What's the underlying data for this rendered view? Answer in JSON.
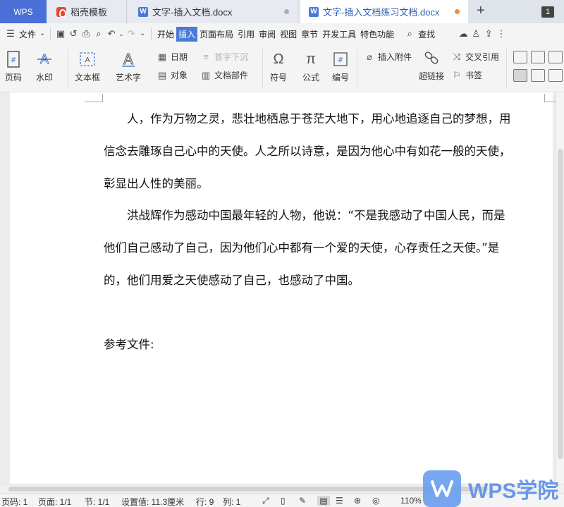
{
  "tabs": {
    "wps": "WPS",
    "template": "稻壳模板",
    "doc1": "文字-插入文档.docx",
    "doc2": "文字-插入文档练习文档.docx",
    "window_count": "1"
  },
  "menu": {
    "file": "文件",
    "items": [
      "开始",
      "插入",
      "页面布局",
      "引用",
      "审阅",
      "视图",
      "章节",
      "开发工具",
      "特色功能"
    ],
    "search": "查找"
  },
  "ribbon": {
    "page_number": "页码",
    "watermark": "水印",
    "textbox": "文本框",
    "art_text": "艺术字",
    "date": "日期",
    "drop_cap": "首字下沉",
    "object": "对象",
    "doc_parts": "文档部件",
    "symbol": "符号",
    "formula": "公式",
    "numbering": "编号",
    "insert_attachment": "插入附件",
    "cross_reference": "交叉引用",
    "hyperlink": "超链接",
    "bookmark": "书签"
  },
  "document": {
    "lines": [
      "人，作为万物之灵，悲壮地栖息于苍茫大地下，用心地追逐自己的梦想，用",
      "信念去雕琢自己心中的天使。人之所以诗意，是因为他心中有如花一般的天使，",
      "彰显出人性的美丽。",
      "洪战辉作为感动中国最年轻的人物，他说：“不是我感动了中国人民，而是",
      "他们自己感动了自己，因为他们心中都有一个爱的天使，心存责任之天使。”是",
      "的，他们用爱之天使感动了自己，也感动了中国。",
      "参考文件:"
    ]
  },
  "status": {
    "page_code": "页码: 1",
    "page": "页面: 1/1",
    "section": "节: 1/1",
    "position": "设置值: 11.3厘米",
    "row": "行: 9",
    "col": "列: 1",
    "zoom": "110%"
  },
  "watermark_logo": "WPS学院",
  "colors": {
    "accent": "#4a7ad8",
    "wps_tab": "#4a6fd6",
    "unsaved_dot": "#f08d3a",
    "logo": "#5b8ee8"
  }
}
